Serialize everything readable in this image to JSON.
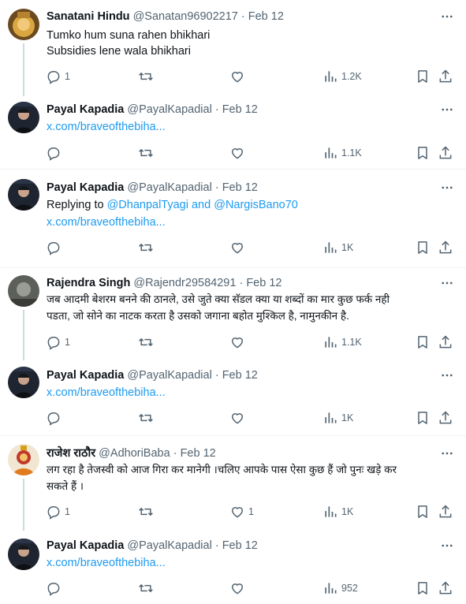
{
  "tweets": [
    {
      "name": "Sanatani Hindu",
      "handle": "@Sanatan96902217",
      "date": "Feb 12",
      "lines": [
        "Tumko hum suna rahen bhikhari",
        "Subsidies lene wala bhikhari"
      ],
      "replies": "1",
      "retweets": "",
      "likes": "",
      "views": "1.2K"
    },
    {
      "name": "Payal Kapadia",
      "handle": "@PayalKapadial",
      "date": "Feb 12",
      "link": "x.com/braveofthebiha...",
      "replies": "",
      "retweets": "",
      "likes": "",
      "views": "1.1K"
    },
    {
      "name": "Payal Kapadia",
      "handle": "@PayalKapadial",
      "date": "Feb 12",
      "replying_prefix": "Replying to ",
      "mention1": "@DhanpalTyagi",
      "and": " and ",
      "mention2": "@NargisBano70",
      "link": "x.com/braveofthebiha...",
      "replies": "",
      "retweets": "",
      "likes": "",
      "views": "1K"
    },
    {
      "name": "Rajendra Singh",
      "handle": "@Rajendr29584291",
      "date": "Feb 12",
      "lines": [
        "जब आदमी बेशरम बनने की ठानले, उसे जुते क्या सॅडल क्या या शब्दों का मार कुछ फर्क नही",
        "पडता, जो सोने का नाटक करता है उसको जगाना बहोत मुश्किल है, नामुनकीन है."
      ],
      "replies": "1",
      "retweets": "",
      "likes": "",
      "views": "1.1K"
    },
    {
      "name": "Payal Kapadia",
      "handle": "@PayalKapadial",
      "date": "Feb 12",
      "link": "x.com/braveofthebiha...",
      "replies": "",
      "retweets": "",
      "likes": "",
      "views": "1K"
    },
    {
      "name": "राजेश राठौर",
      "handle": "@AdhoriBaba",
      "date": "Feb 12",
      "lines": [
        "लग रहा है तेजस्वी को आज गिरा कर मानेगी ।चलिए आपके पास ऐसा कुछ हैं जो पुनः खड़े कर",
        "सकते हैं ।"
      ],
      "replies": "1",
      "retweets": "",
      "likes": "1",
      "views": "1K"
    },
    {
      "name": "Payal Kapadia",
      "handle": "@PayalKapadial",
      "date": "Feb 12",
      "link": "x.com/braveofthebiha...",
      "replies": "",
      "retweets": "",
      "likes": "",
      "views": "952"
    }
  ],
  "colors": {
    "text": "#0f1419",
    "secondary": "#536471",
    "link": "#1d9bf0",
    "divider": "#eff3f4",
    "thread_line": "#cfd9de"
  },
  "icons": [
    "more-icon",
    "reply-icon",
    "retweet-icon",
    "like-icon",
    "views-icon",
    "bookmark-icon",
    "share-icon"
  ]
}
